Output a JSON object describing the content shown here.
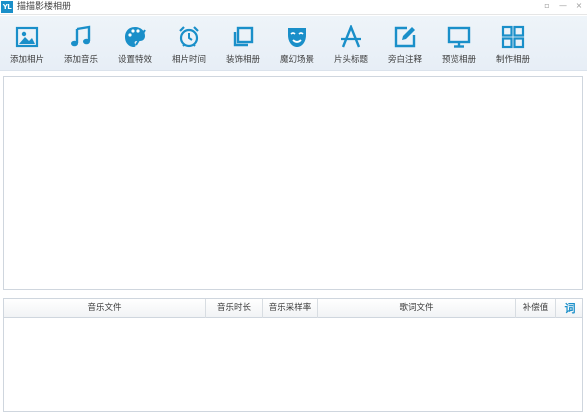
{
  "app": {
    "logo": "YL",
    "title": "描描影楼相册",
    "window_controls": {
      "skin": "▫",
      "minimize": "—",
      "close": "×"
    }
  },
  "toolbar": {
    "accent_color": "#1a8fc9",
    "items": [
      {
        "label": "添加相片",
        "icon": "add-photo-icon"
      },
      {
        "label": "添加音乐",
        "icon": "music-note-icon"
      },
      {
        "label": "设置特效",
        "icon": "palette-icon"
      },
      {
        "label": "相片时间",
        "icon": "alarm-clock-icon"
      },
      {
        "label": "装饰相册",
        "icon": "copy-frame-icon"
      },
      {
        "label": "魔幻场景",
        "icon": "theater-mask-icon"
      },
      {
        "label": "片头标题",
        "icon": "title-a-icon"
      },
      {
        "label": "旁白注释",
        "icon": "edit-note-icon"
      },
      {
        "label": "预览相册",
        "icon": "monitor-icon"
      },
      {
        "label": "制作相册",
        "icon": "grid-icon"
      }
    ]
  },
  "music_table": {
    "columns": [
      "音乐文件",
      "音乐时长",
      "音乐采样率",
      "歌词文件",
      "补偿值"
    ],
    "tool_button": "词",
    "rows": []
  }
}
